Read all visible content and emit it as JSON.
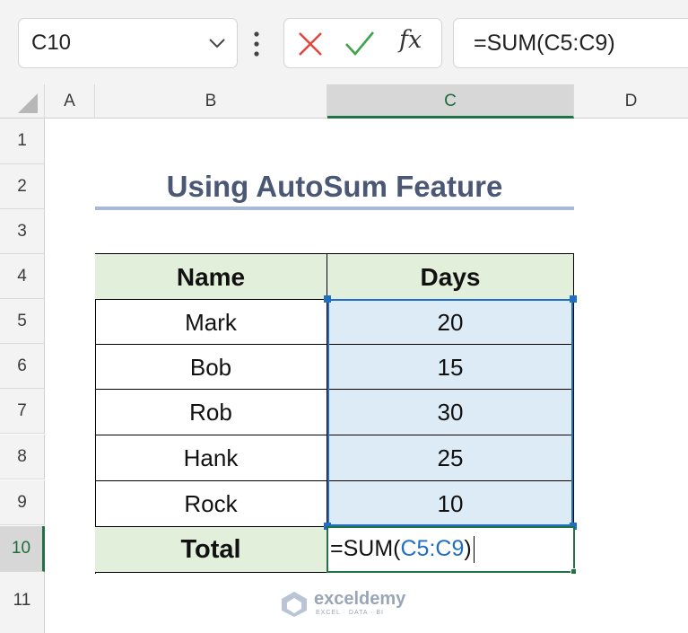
{
  "formula_bar": {
    "name_box": "C10",
    "formula": "=SUM(C5:C9)",
    "fx_label": "fx"
  },
  "columns": [
    "A",
    "B",
    "C",
    "D"
  ],
  "rows": [
    "1",
    "2",
    "3",
    "4",
    "5",
    "6",
    "7",
    "8",
    "9",
    "10",
    "11"
  ],
  "sheet": {
    "title": "Using AutoSum Feature",
    "table": {
      "headers": [
        "Name",
        "Days"
      ],
      "rows": [
        {
          "name": "Mark",
          "days": "20"
        },
        {
          "name": "Bob",
          "days": "15"
        },
        {
          "name": "Rob",
          "days": "30"
        },
        {
          "name": "Hank",
          "days": "25"
        },
        {
          "name": "Rock",
          "days": "10"
        }
      ],
      "total_label": "Total"
    },
    "editing": {
      "prefix": "=SUM(",
      "range": "C5:C9",
      "suffix": ")"
    }
  },
  "watermark": {
    "name": "exceldemy",
    "tagline": "EXCEL · DATA · BI"
  },
  "colors": {
    "accent_green": "#217346",
    "range_blue": "#1f6fc4",
    "header_fill": "#e2efda",
    "days_fill": "#ddebf7",
    "cancel_red": "#e0473f",
    "enter_green": "#3fa34d"
  },
  "icons": [
    "chevron-down-icon",
    "more-options-icon",
    "cancel-icon",
    "enter-icon",
    "insert-function-icon",
    "exceldemy-logo-icon"
  ]
}
